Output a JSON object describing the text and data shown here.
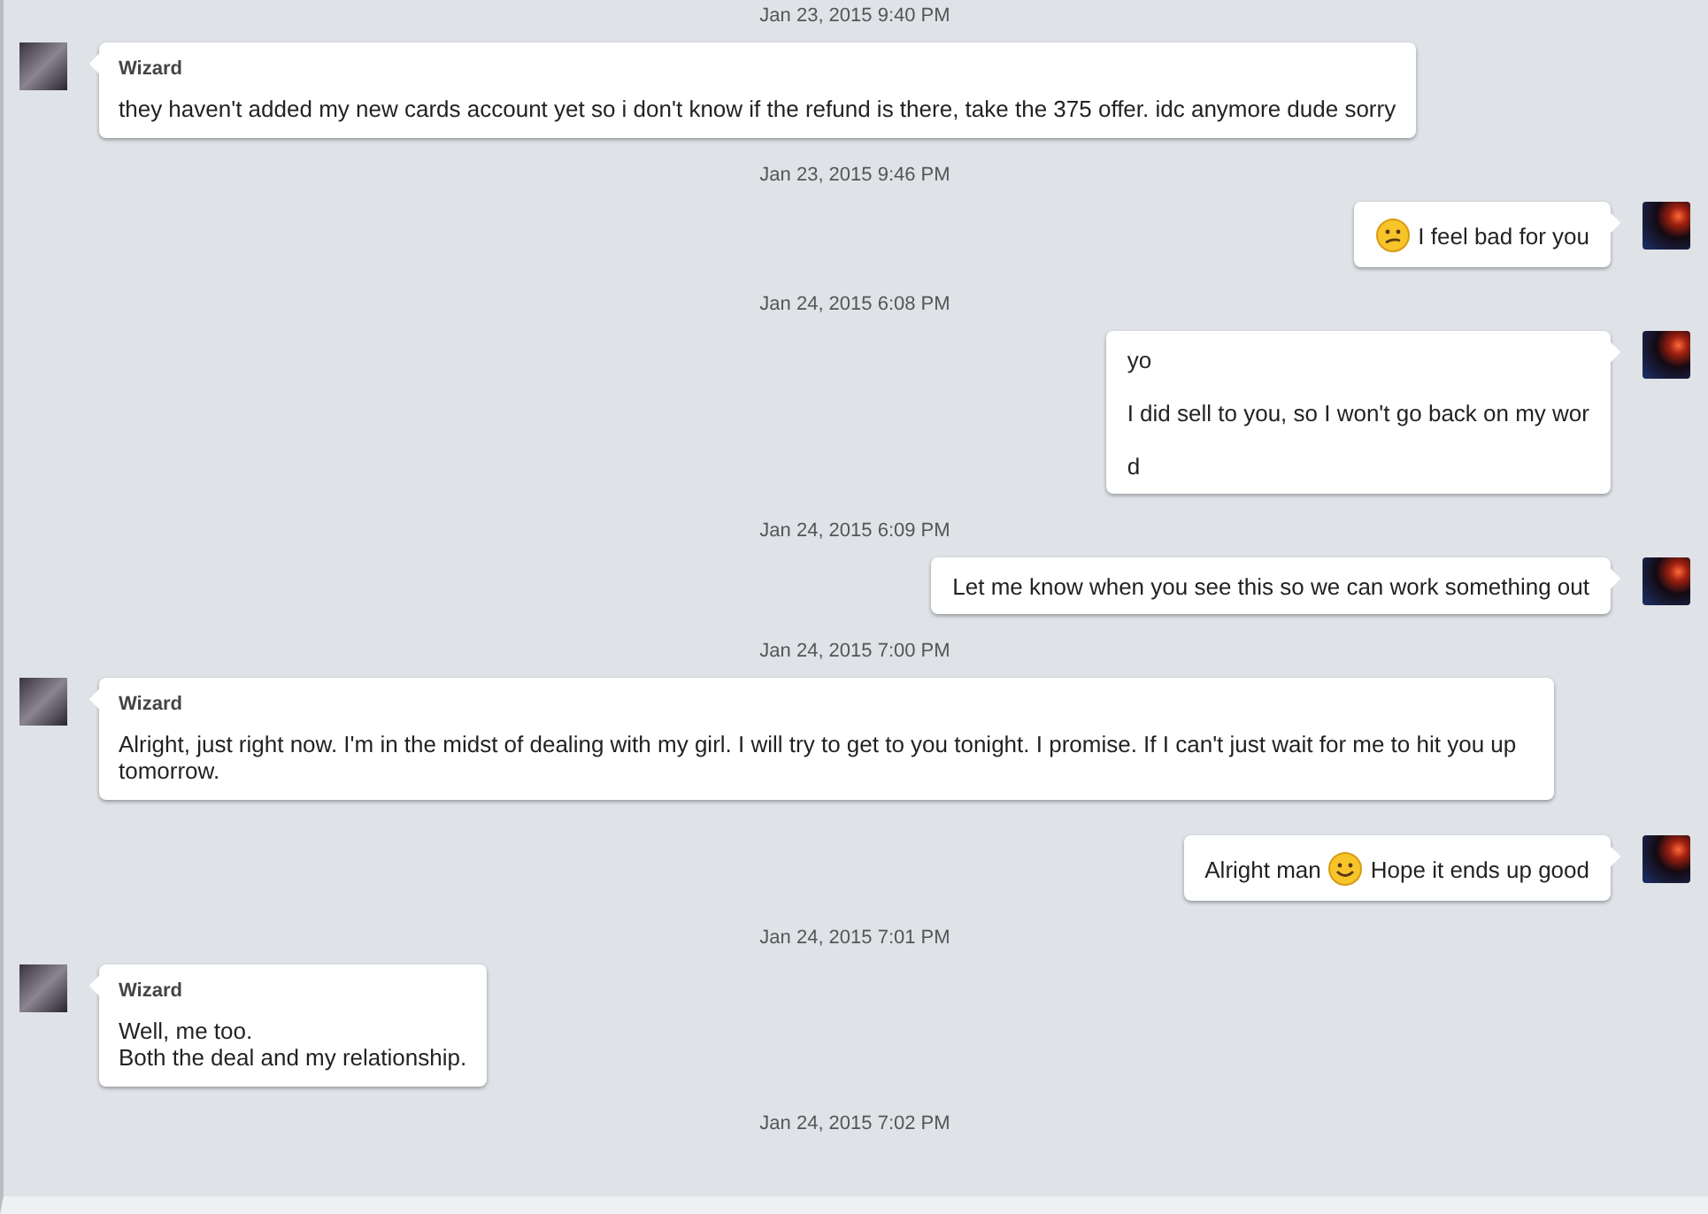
{
  "conversation": [
    {
      "kind": "timestamp",
      "text": "Jan 23, 2015 9:40 PM"
    },
    {
      "kind": "message",
      "outgoing": false,
      "sender": "Wizard",
      "lines": [
        [
          {
            "kind": "text",
            "text": "they haven't added my new cards account yet so i don't know if the refund is there, take the 375 offer. idc anymore dude sorry"
          }
        ]
      ]
    },
    {
      "kind": "timestamp",
      "text": "Jan 23, 2015 9:46 PM"
    },
    {
      "kind": "message",
      "outgoing": true,
      "lines": [
        [
          {
            "kind": "confused_emoji"
          },
          {
            "kind": "text",
            "text": "I feel bad for you"
          }
        ]
      ]
    },
    {
      "kind": "timestamp",
      "text": "Jan 24, 2015 6:08 PM"
    },
    {
      "kind": "message",
      "outgoing": true,
      "lines": [
        [
          {
            "kind": "text",
            "text": "yo"
          }
        ],
        [
          {
            "kind": "text",
            "text": "I did sell to you, so I won't go back on my wor"
          }
        ],
        [
          {
            "kind": "text",
            "text": "d"
          }
        ]
      ]
    },
    {
      "kind": "timestamp",
      "text": "Jan 24, 2015 6:09 PM"
    },
    {
      "kind": "message",
      "outgoing": true,
      "lines": [
        [
          {
            "kind": "text",
            "text": "Let me know when you see this so we can work something out"
          }
        ]
      ]
    },
    {
      "kind": "timestamp",
      "text": "Jan 24, 2015 7:00 PM"
    },
    {
      "kind": "message",
      "outgoing": false,
      "sender": "Wizard",
      "lines": [
        [
          {
            "kind": "text",
            "text": "Alright, just right now. I'm in the midst of dealing with my girl. I will try to get to you tonight. I promise. If I can't just wait for me to hit you up tomorrow."
          }
        ]
      ]
    },
    {
      "kind": "message",
      "outgoing": true,
      "lines": [
        [
          {
            "kind": "text",
            "text": "Alright man"
          },
          {
            "kind": "smile_emoji"
          },
          {
            "kind": "text",
            "text": "Hope it ends up good"
          }
        ]
      ]
    },
    {
      "kind": "timestamp",
      "text": "Jan 24, 2015 7:01 PM"
    },
    {
      "kind": "message",
      "outgoing": false,
      "sender": "Wizard",
      "lines": [
        [
          {
            "kind": "text",
            "text": "Well, me too."
          }
        ],
        [
          {
            "kind": "text",
            "text": "Both the deal and my relationship."
          }
        ]
      ]
    },
    {
      "kind": "timestamp",
      "text": "Jan 24, 2015 7:02 PM"
    }
  ]
}
